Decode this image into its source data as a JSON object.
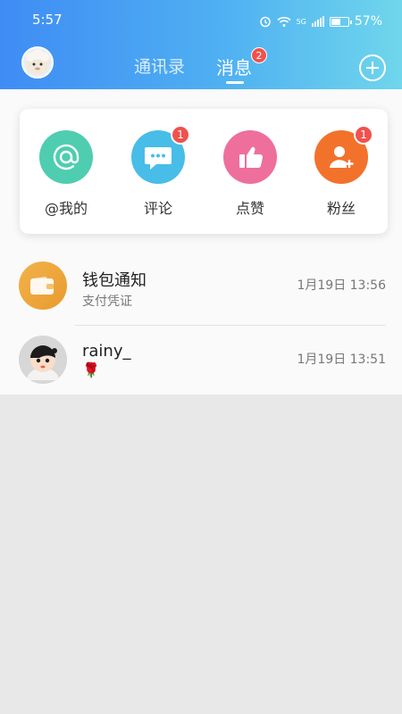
{
  "status": {
    "time": "5:57",
    "network": "5G",
    "battery_percent_text": "57%",
    "battery_level": 0.57
  },
  "header": {
    "tabs": [
      {
        "label": "通讯录"
      },
      {
        "label": "消息"
      }
    ],
    "messages_badge": "2",
    "accent_colors": [
      "#3f8cf4",
      "#6fd6ec"
    ]
  },
  "quick_actions": [
    {
      "label": "@我的",
      "icon": "at-icon",
      "color": "#4fcdb0",
      "badge": ""
    },
    {
      "label": "评论",
      "icon": "comment-icon",
      "color": "#47bde8",
      "badge": "1"
    },
    {
      "label": "点赞",
      "icon": "thumbs-up-icon",
      "color": "#ee6f9c",
      "badge": ""
    },
    {
      "label": "粉丝",
      "icon": "add-user-icon",
      "color": "#f2722b",
      "badge": "1"
    }
  ],
  "conversations": [
    {
      "name": "钱包通知",
      "subtitle": "支付凭证",
      "time": "1月19日 13:56",
      "avatar": "wallet-icon"
    },
    {
      "name": "rainy_",
      "subtitle": "🌹",
      "time": "1月19日 13:51",
      "avatar": "user-avatar"
    }
  ]
}
